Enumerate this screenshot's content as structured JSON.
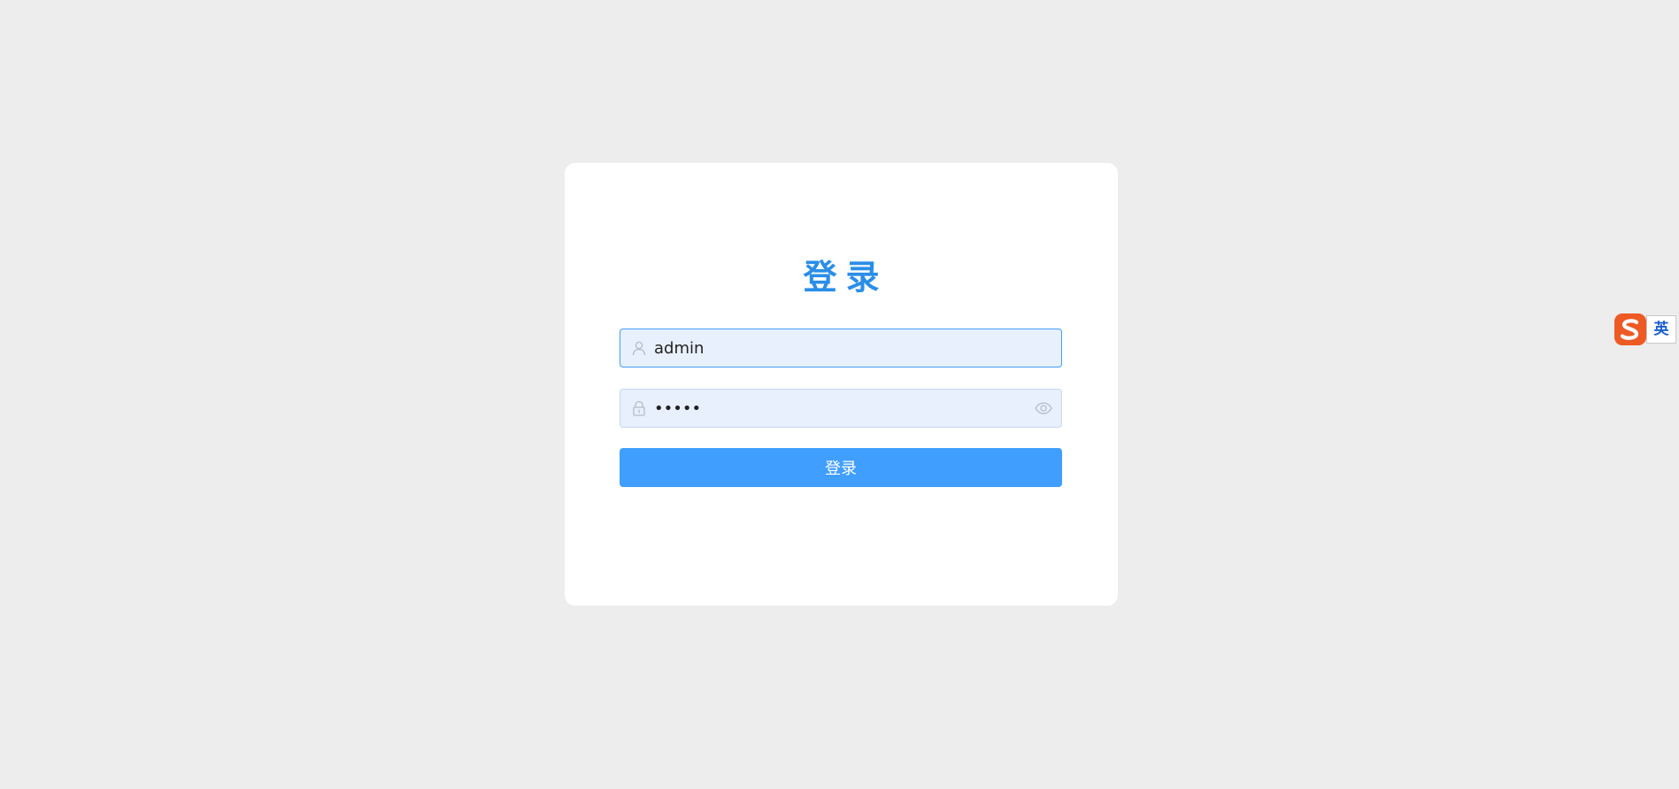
{
  "login": {
    "title": "登录",
    "username": {
      "value": "admin",
      "icon": "user-icon"
    },
    "password": {
      "value": "•••••",
      "icon": "lock-icon",
      "toggle_icon": "eye-icon"
    },
    "submit_label": "登录"
  },
  "ime": {
    "logo_icon": "sogou-s-icon",
    "mode_label": "英"
  },
  "colors": {
    "background": "#ededed",
    "card": "#ffffff",
    "accent": "#409eff",
    "title": "#2a8ee8",
    "input_fill": "#e8f0fd"
  }
}
